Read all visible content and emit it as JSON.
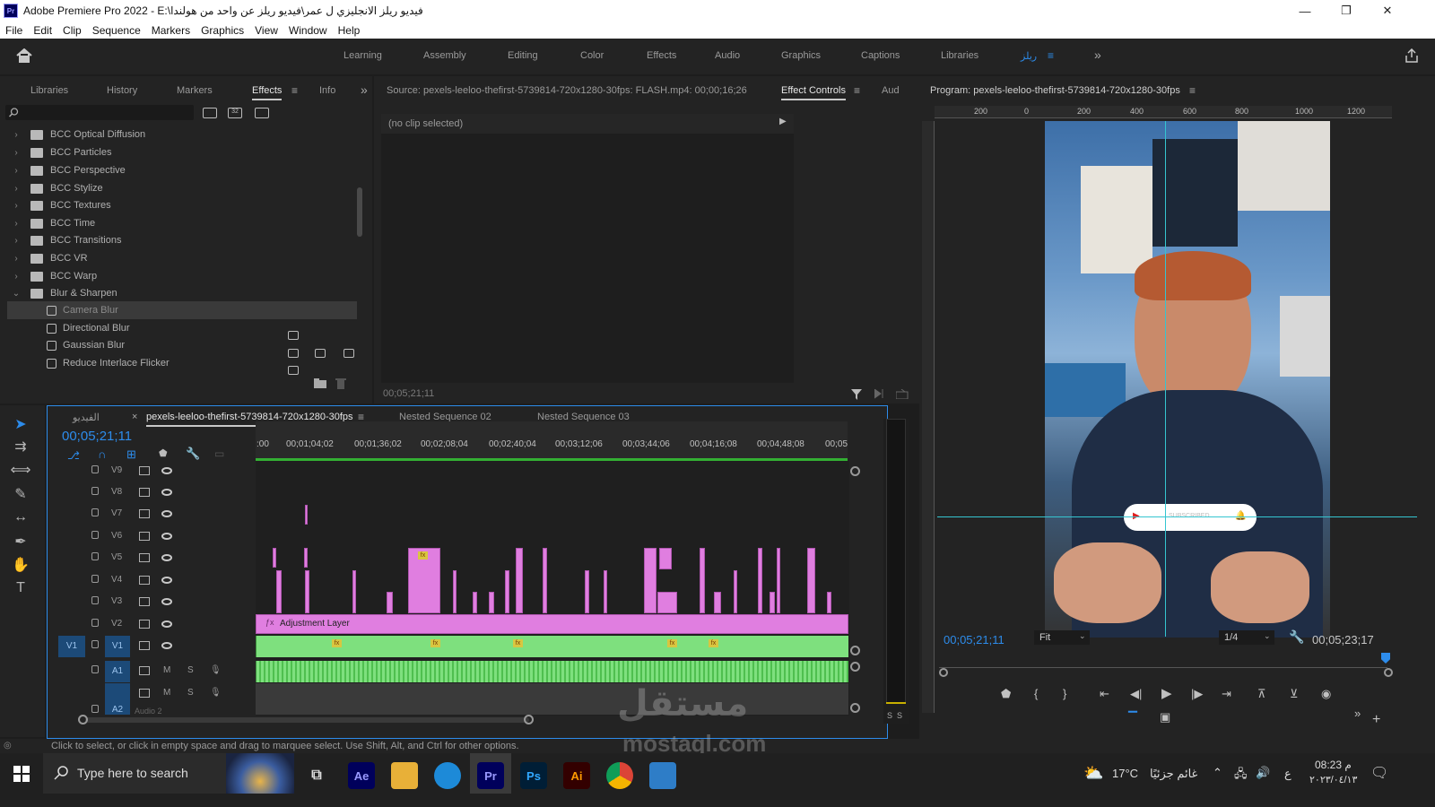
{
  "window": {
    "title": "Adobe Premiere Pro 2022 - E:\\فيديو ريلز الانجليزي ل عمر\\فيديو ريلز عن واحد من هولندا",
    "app_icon": "Pr",
    "minimize": "—",
    "maximize": "❐",
    "close": "✕"
  },
  "menu": [
    "File",
    "Edit",
    "Clip",
    "Sequence",
    "Markers",
    "Graphics",
    "View",
    "Window",
    "Help"
  ],
  "workspaces": [
    "Learning",
    "Assembly",
    "Editing",
    "Color",
    "Effects",
    "Audio",
    "Graphics",
    "Captions",
    "Libraries",
    "ريلز"
  ],
  "project_panel": {
    "tabs": [
      "Libraries",
      "History",
      "Markers",
      "Effects",
      "Info"
    ],
    "active_tab": "Effects",
    "search_placeholder": "",
    "toolbar_badges": [
      "32"
    ],
    "tree": [
      {
        "label": "BCC Optical Diffusion",
        "type": "folder"
      },
      {
        "label": "BCC Particles",
        "type": "folder"
      },
      {
        "label": "BCC Perspective",
        "type": "folder"
      },
      {
        "label": "BCC Stylize",
        "type": "folder"
      },
      {
        "label": "BCC Textures",
        "type": "folder"
      },
      {
        "label": "BCC Time",
        "type": "folder"
      },
      {
        "label": "BCC Transitions",
        "type": "folder"
      },
      {
        "label": "BCC VR",
        "type": "folder"
      },
      {
        "label": "BCC Warp",
        "type": "folder"
      },
      {
        "label": "Blur & Sharpen",
        "type": "folder-open"
      },
      {
        "label": "Camera Blur",
        "type": "effect",
        "selected": true
      },
      {
        "label": "Directional Blur",
        "type": "effect"
      },
      {
        "label": "Gaussian Blur",
        "type": "effect"
      },
      {
        "label": "Reduce Interlace Flicker",
        "type": "effect"
      }
    ]
  },
  "source_panel": {
    "source_tab": "Source: pexels-leeloo-thefirst-5739814-720x1280-30fps: FLASH.mp4: 00;00;16;26",
    "effect_controls_tab": "Effect Controls",
    "audio_tab": "Aud",
    "no_clip": "(no clip selected)",
    "timecode": "00;05;21;11"
  },
  "program_panel": {
    "title": "Program: pexels-leeloo-thefirst-5739814-720x1280-30fps",
    "ruler": [
      "200",
      "0",
      "200",
      "400",
      "600",
      "800",
      "1000",
      "1200"
    ],
    "timecode_left": "00;05;21;11",
    "fit": "Fit",
    "resolution": "1/4",
    "timecode_right": "00;05;23;17",
    "overlay_text": "SUBSCRIBED"
  },
  "timeline": {
    "tabs": [
      "الفيديو",
      "pexels-leeloo-thefirst-5739814-720x1280-30fps",
      "Nested Sequence 02",
      "Nested Sequence 03"
    ],
    "active_tab_index": 1,
    "timecode": "00;05;21;11",
    "ruler": [
      ":00",
      "00;01;04;02",
      "00;01;36;02",
      "00;02;08;04",
      "00;02;40;04",
      "00;03;12;06",
      "00;03;44;06",
      "00;04;16;08",
      "00;04;48;08",
      "00;05"
    ],
    "video_tracks": [
      "V9",
      "V8",
      "V7",
      "V6",
      "V5",
      "V4",
      "V3",
      "V2",
      "V1"
    ],
    "source_patch": "V1",
    "audio_tracks": [
      "A1",
      "A2"
    ],
    "audio_buttons": [
      "M",
      "S"
    ],
    "adjustment_layer": "Adjustment Layer",
    "fx_label": "fx",
    "audio2_label": "Audio 2",
    "meter_labels": [
      "S",
      "S"
    ]
  },
  "status_bar": "Click to select, or click in empty space and drag to marquee select. Use Shift, Alt, and Ctrl for other options.",
  "taskbar": {
    "search": "Type here to search",
    "apps": [
      "Ae",
      "Ps",
      "Ai"
    ],
    "weather_temp": "17°C",
    "weather_text": "غائم جزئيًا",
    "time": "08:23 م",
    "date": "٢٠٢٣/٠٤/١٣",
    "lang": "ع"
  },
  "watermark": {
    "logo": "مستقل",
    "url": "mostaql.com"
  },
  "colors": {
    "accent": "#2d8ceb",
    "video_clip": "#e07ee0",
    "audio_clip": "#7ee07e",
    "bg": "#1d1d1d"
  }
}
